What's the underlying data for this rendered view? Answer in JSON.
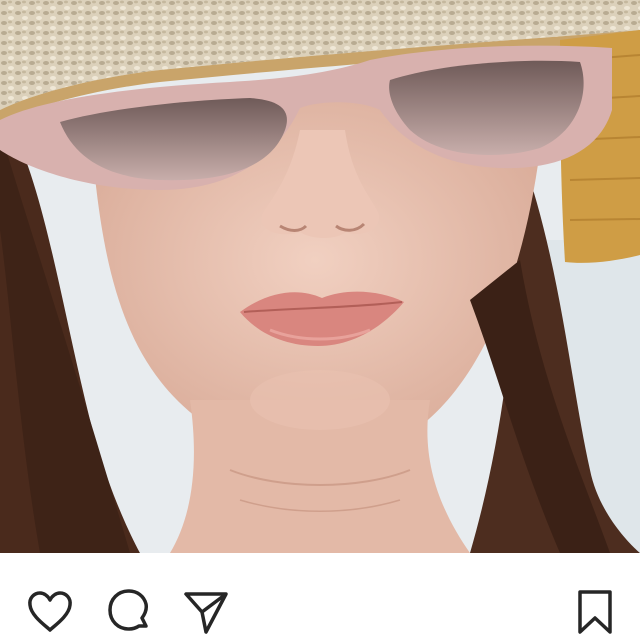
{
  "post": {
    "photo": {
      "subject": "selfie",
      "colors": {
        "hat_straw": "#d8cdb6",
        "hat_band": "#c9a46a",
        "hat_brim": "#cf9d45",
        "sunglasses_frame": "#d8b1ae",
        "sunglasses_lens": "#a48a88",
        "skin": "#e9c3b3",
        "lips": "#d9867f",
        "hair": "#4a2a1c",
        "background": "#e8ecef"
      }
    },
    "actions": {
      "icon_color": "#262626",
      "like_icon": "heart-icon",
      "comment_icon": "speech-bubble-icon",
      "share_icon": "paper-plane-icon",
      "save_icon": "bookmark-icon"
    }
  }
}
